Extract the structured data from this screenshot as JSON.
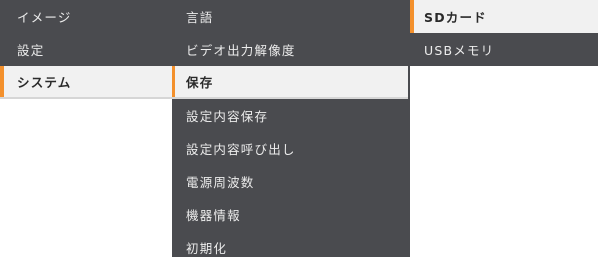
{
  "menu": {
    "main": [
      {
        "label": "イメージ",
        "selected": false
      },
      {
        "label": "設定",
        "selected": false
      },
      {
        "label": "システム",
        "selected": true
      }
    ],
    "system": [
      {
        "label": "言語",
        "selected": false
      },
      {
        "label": "ビデオ出力解像度",
        "selected": false
      },
      {
        "label": "保存",
        "selected": true
      },
      {
        "label": "設定内容保存",
        "selected": false
      },
      {
        "label": "設定内容呼び出し",
        "selected": false
      },
      {
        "label": "電源周波数",
        "selected": false
      },
      {
        "label": "機器情報",
        "selected": false
      },
      {
        "label": "初期化",
        "selected": false
      }
    ],
    "save": [
      {
        "label": "SDカード",
        "selected": true
      },
      {
        "label": "USBメモリ",
        "selected": false
      }
    ]
  },
  "colors": {
    "panel": "#4a4b4f",
    "selected_bg": "#f1f1f1",
    "accent": "#f3902c"
  }
}
